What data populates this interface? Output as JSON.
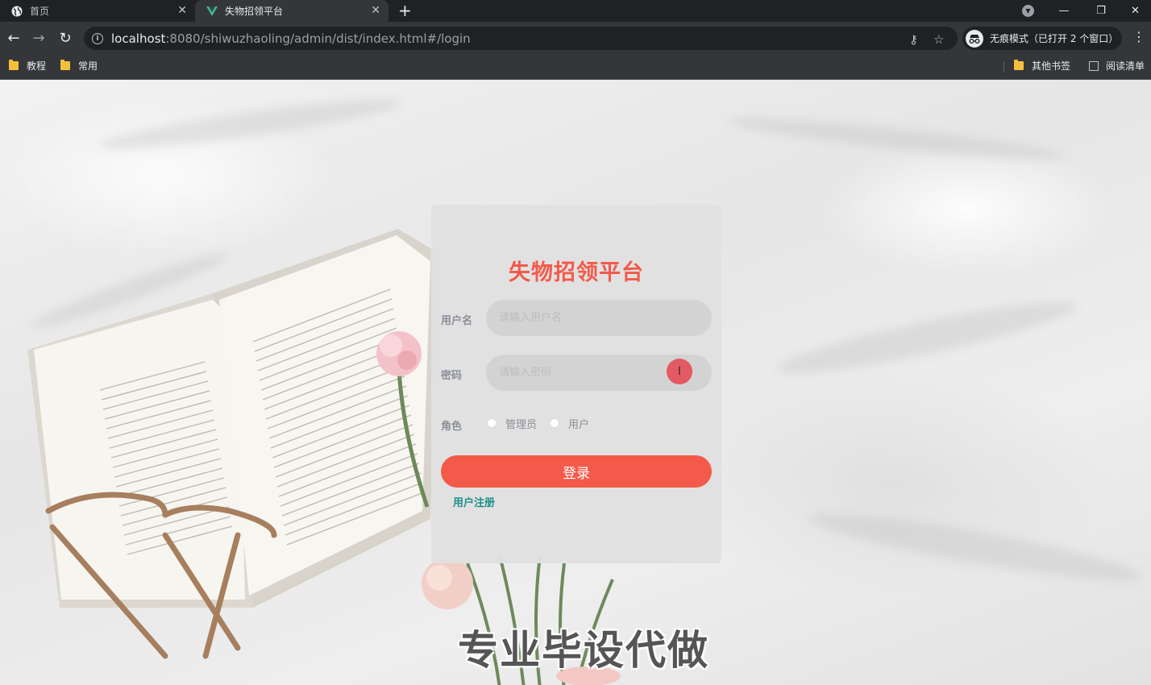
{
  "tabs": [
    {
      "title": "首页",
      "active": false
    },
    {
      "title": "失物招领平台",
      "active": true
    }
  ],
  "address": {
    "host": "localhost",
    "path": ":8080/shiwuzhaoling/admin/dist/index.html#/login"
  },
  "incognito": {
    "label": "无痕模式（已打开 2 个窗口）"
  },
  "bookmarks": {
    "left": [
      "教程",
      "常用"
    ],
    "other": "其他书签",
    "reading_list": "阅读清单"
  },
  "login": {
    "title": "失物招领平台",
    "username": {
      "label": "用户名",
      "placeholder": "请输入用户名"
    },
    "password": {
      "label": "密码",
      "placeholder": "请输入密码"
    },
    "role": {
      "label": "角色",
      "options": [
        "管理员",
        "用户"
      ],
      "selected": null
    },
    "submit_label": "登录",
    "register_link": "用户注册"
  },
  "watermark": "专业毕设代做",
  "colors": {
    "accent": "#f35a4a",
    "link": "#1f8f8a",
    "chrome_dark": "#202124",
    "chrome_mid": "#35363a"
  }
}
